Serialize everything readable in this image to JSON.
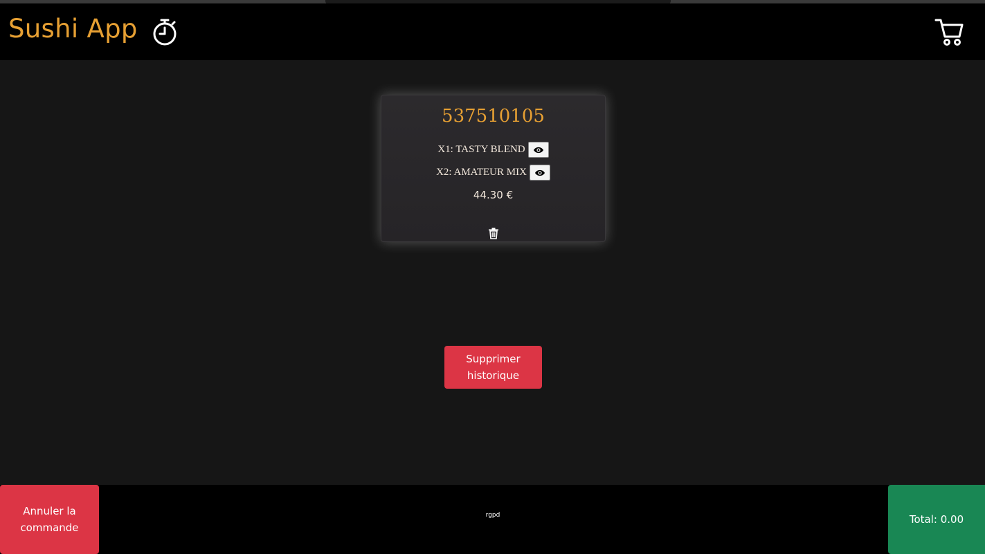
{
  "header": {
    "brand": "Sushi App",
    "timer_icon": "stopwatch-icon",
    "cart_icon": "cart-icon"
  },
  "order": {
    "number": "537510105",
    "items": [
      {
        "label": "X1: TASTY BLEND",
        "icon": "eye-icon"
      },
      {
        "label": "X2: AMATEUR MIX",
        "icon": "eye-icon"
      }
    ],
    "price": "44.30 €",
    "delete_icon": "trash-icon"
  },
  "actions": {
    "clear_history": "Supprimer historique"
  },
  "footer": {
    "cancel": "Annuler la commande",
    "rgpd": "rgpd",
    "total": "Total: 0.00"
  },
  "colors": {
    "brand": "#e7a033",
    "danger": "#dc3545",
    "success": "#198754",
    "background": "#161616"
  }
}
